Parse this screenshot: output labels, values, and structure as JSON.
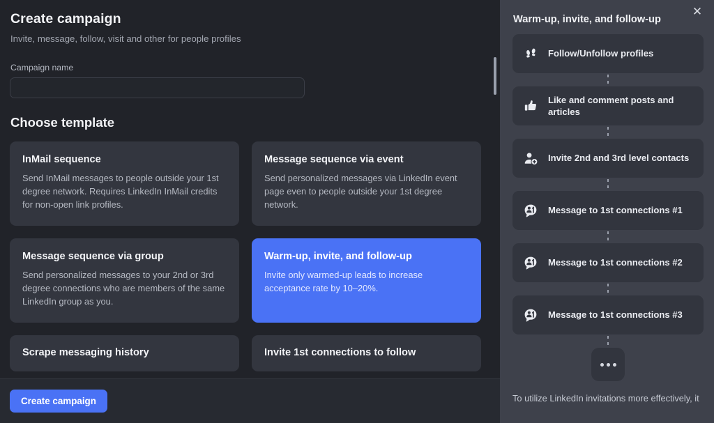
{
  "main": {
    "title": "Create campaign",
    "subtitle": "Invite, message, follow, visit and other for people profiles",
    "campaign_name_label": "Campaign name",
    "campaign_name_value": "",
    "campaign_name_placeholder": "",
    "choose_template_title": "Choose template",
    "templates": [
      {
        "name": "InMail sequence",
        "description": "Send InMail messages to people outside your 1st degree network. Requires LinkedIn InMail credits for non-open link profiles.",
        "selected": false
      },
      {
        "name": "Message sequence via event",
        "description": "Send personalized messages via LinkedIn event page even to people outside your 1st degree network.",
        "selected": false
      },
      {
        "name": "Message sequence via group",
        "description": "Send personalized messages to your 2nd or 3rd degree connections who are members of the same LinkedIn group as you.",
        "selected": false
      },
      {
        "name": "Warm-up, invite, and follow-up",
        "description": "Invite only warmed-up leads to increase acceptance rate by 10–20%.",
        "selected": true
      },
      {
        "name": "Scrape messaging history",
        "description": "",
        "selected": false
      },
      {
        "name": "Invite 1st connections to follow",
        "description": "",
        "selected": false
      }
    ]
  },
  "footer": {
    "create_campaign_label": "Create campaign"
  },
  "sidebar": {
    "title": "Warm-up, invite, and follow-up",
    "close_label": "✕",
    "steps": [
      {
        "label": "Follow/Unfollow profiles",
        "icon": "footsteps-icon"
      },
      {
        "label": "Like and comment posts and articles",
        "icon": "thumbs-up-icon"
      },
      {
        "label": "Invite 2nd and 3rd level contacts",
        "icon": "person-add-icon"
      },
      {
        "label": "Message to 1st connections #1",
        "icon": "message-person-icon"
      },
      {
        "label": "Message to 1st connections #2",
        "icon": "message-person-icon"
      },
      {
        "label": "Message to 1st connections #3",
        "icon": "message-person-icon"
      }
    ],
    "note": "To utilize LinkedIn invitations more effectively, it"
  },
  "colors": {
    "accent": "#4a72f5",
    "left_panel_bg": "#212329",
    "right_panel_bg": "#3e414b",
    "card_bg": "#33363f"
  }
}
